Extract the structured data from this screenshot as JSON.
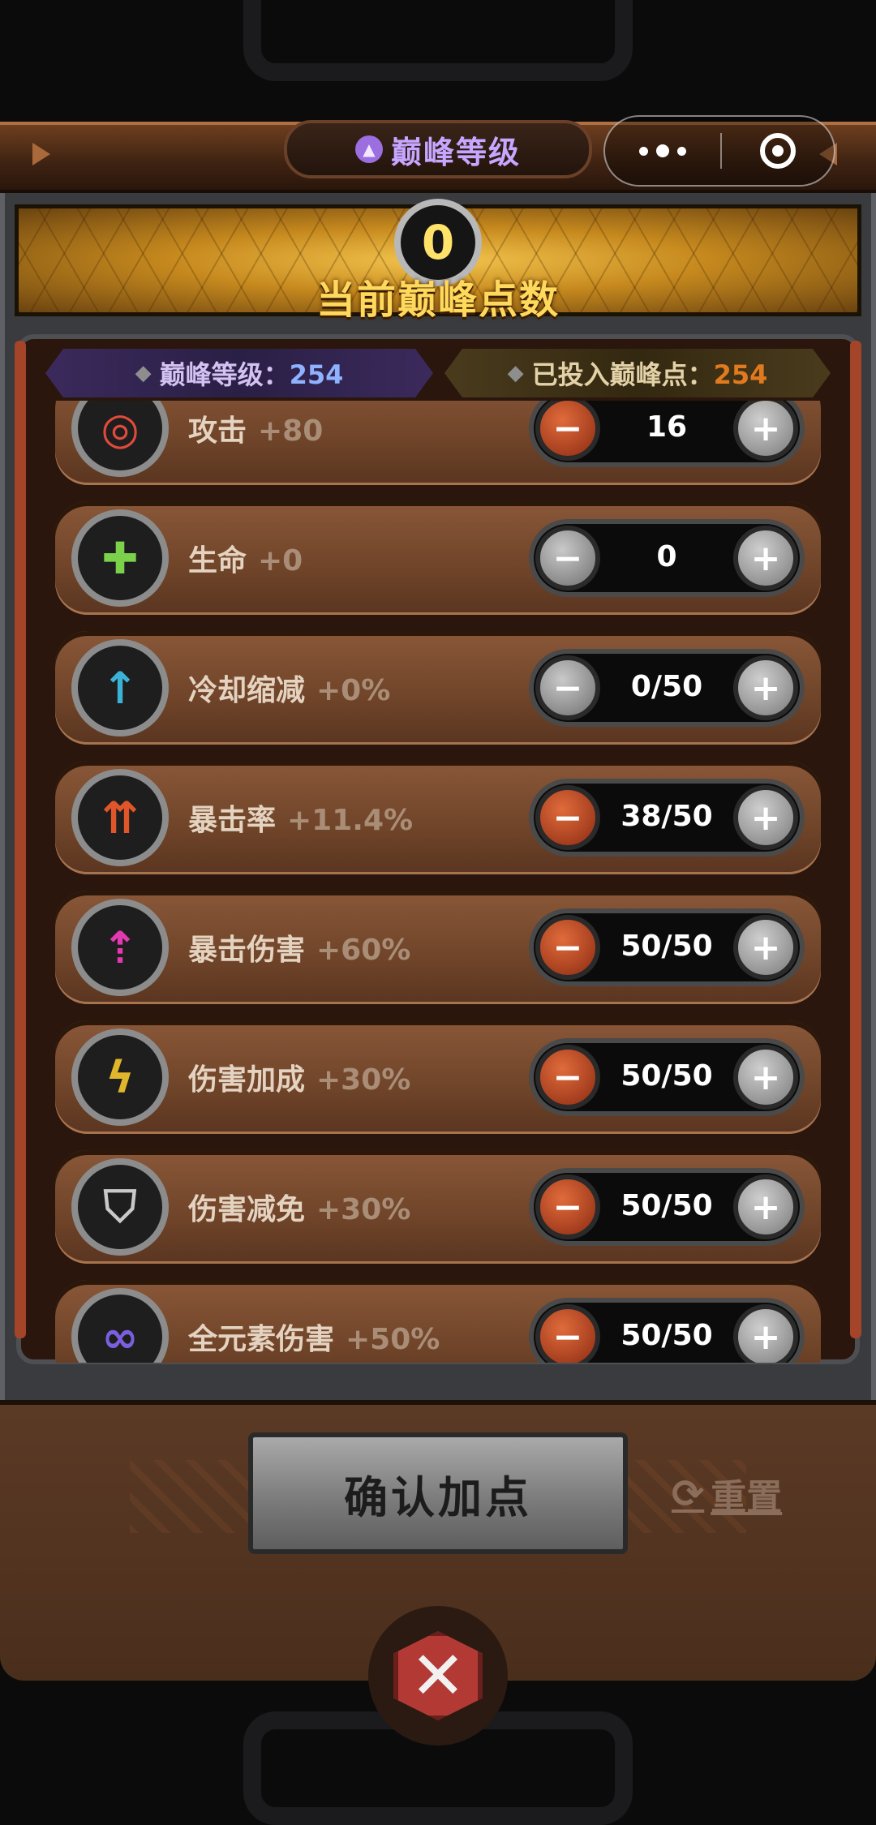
{
  "header": {
    "title": "巅峰等级",
    "title_icon": "peak-crown-icon",
    "capsule_more_icon": "more-dots-icon",
    "capsule_close_icon": "target-ring-icon"
  },
  "banner": {
    "points_value": "0",
    "points_label": "当前巅峰点数"
  },
  "info": {
    "level_label": "巅峰等级：",
    "level_value": "254",
    "invested_label": "已投入巅峰点：",
    "invested_value": "254"
  },
  "stats": [
    {
      "name": "攻击",
      "bonus": "+80",
      "value": "16",
      "icon": "attack-target-icon",
      "color": "#e04a3c",
      "minus_enabled": true
    },
    {
      "name": "生命",
      "bonus": "+0",
      "value": "0",
      "icon": "life-cross-icon",
      "color": "#7bd14a",
      "minus_enabled": false
    },
    {
      "name": "冷却缩减",
      "bonus": "+0%",
      "value": "0/50",
      "icon": "cooldown-clock-icon",
      "color": "#3bb3d6",
      "minus_enabled": false
    },
    {
      "name": "暴击率",
      "bonus": "+11.4%",
      "value": "38/50",
      "icon": "crit-rate-arrows-icon",
      "color": "#e0562a",
      "minus_enabled": true
    },
    {
      "name": "暴击伤害",
      "bonus": "+60%",
      "value": "50/50",
      "icon": "crit-damage-arrows-icon",
      "color": "#e33ab0",
      "minus_enabled": true
    },
    {
      "name": "伤害加成",
      "bonus": "+30%",
      "value": "50/50",
      "icon": "damage-bolt-icon",
      "color": "#e0b72c",
      "minus_enabled": true
    },
    {
      "name": "伤害减免",
      "bonus": "+30%",
      "value": "50/50",
      "icon": "shield-icon",
      "color": "#c9c9c9",
      "minus_enabled": true
    },
    {
      "name": "全元素伤害",
      "bonus": "+50%",
      "value": "50/50",
      "icon": "elements-orbs-icon",
      "color": "#7b5fe0",
      "minus_enabled": true
    }
  ],
  "actions": {
    "confirm_label": "确认加点",
    "reset_label": "重置",
    "reset_icon": "refresh-icon",
    "close_icon": "close-x-icon"
  },
  "colors": {
    "accent_purple": "#c7a6ff",
    "level_blue": "#8fb2ff",
    "invested_orange": "#e07a1e",
    "points_gold": "#ffe26a"
  }
}
